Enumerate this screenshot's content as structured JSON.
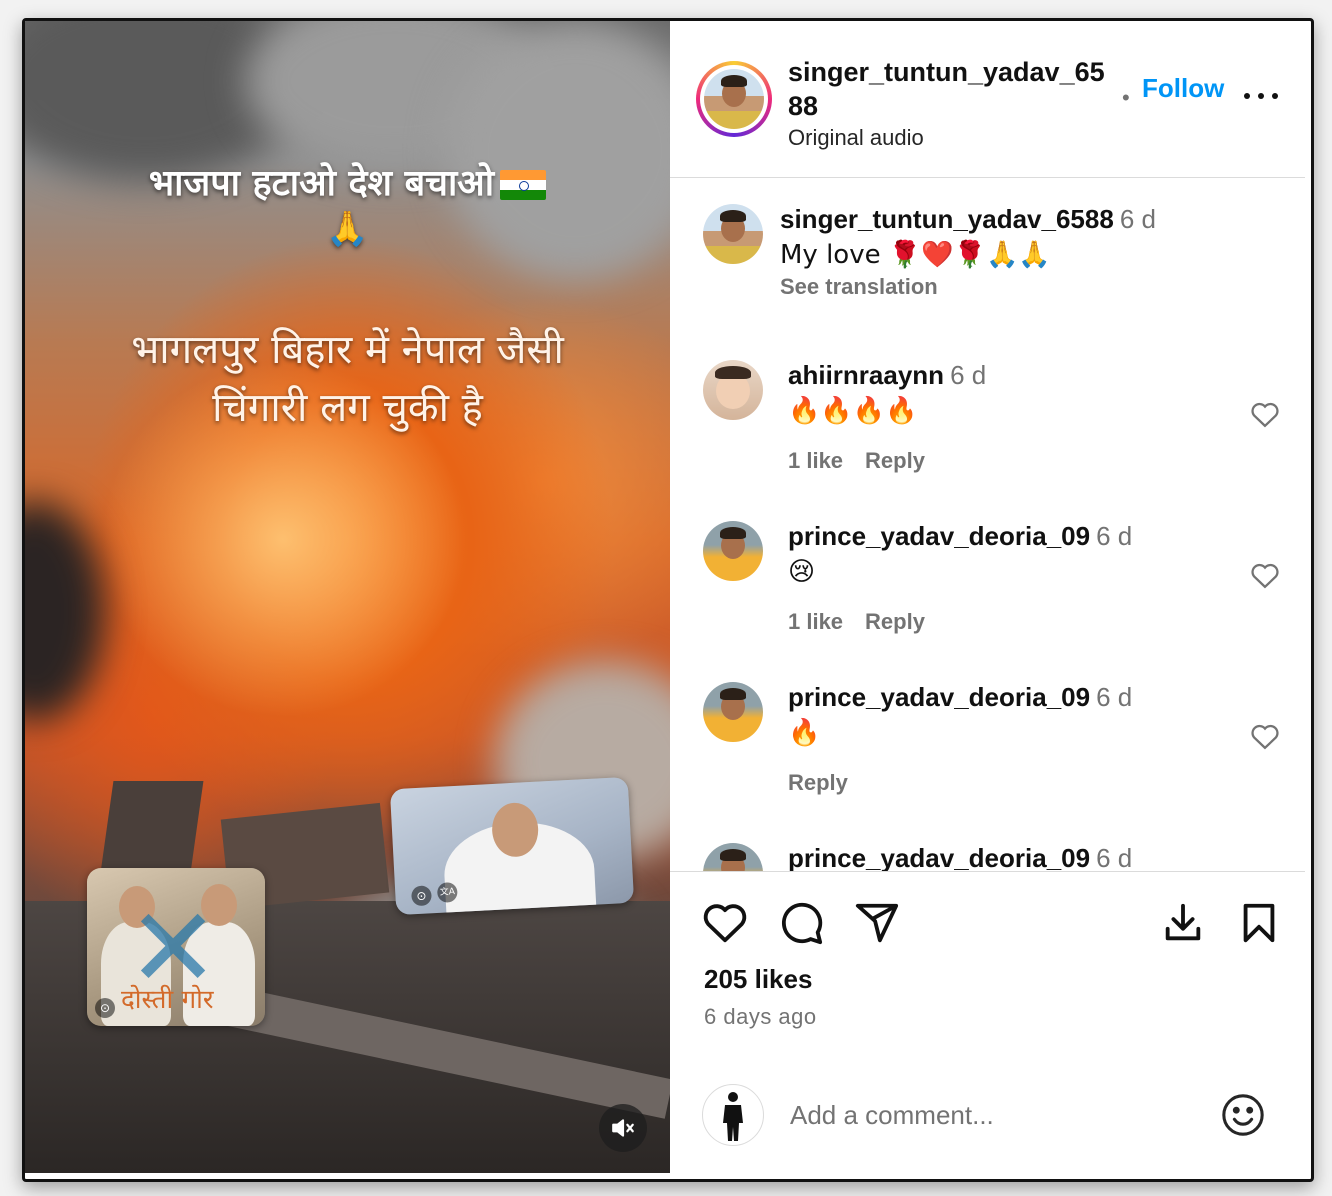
{
  "media": {
    "headline": "भाजपा हटाओ देश बचाओ",
    "headline_emoji": "🙏",
    "overlay_text_line1": "भागलपुर बिहार में नेपाल जैसी",
    "overlay_text_line2": "चिंगारी लग चुकी है",
    "sticker_left_caption": "दोस्ती गोर",
    "sticker_left_mark": "✕",
    "sticker_icon_glyph": "⊙",
    "sticker_translate_glyph": "文A"
  },
  "header": {
    "username": "singer_tuntun_yadav_6588",
    "audio": "Original audio",
    "separator": "•",
    "follow_label": "Follow"
  },
  "caption": {
    "username": "singer_tuntun_yadav_6588",
    "time": "6 d",
    "text": "My love 🌹❤️🌹🙏🙏",
    "translation_label": "See translation"
  },
  "comments": [
    {
      "username": "ahiirnraaynn",
      "time": "6 d",
      "text": "🔥🔥🔥🔥",
      "likes": "1 like",
      "reply": "Reply"
    },
    {
      "username": "prince_yadav_deoria_09",
      "time": "6 d",
      "text": "😢",
      "likes": "1 like",
      "reply": "Reply"
    },
    {
      "username": "prince_yadav_deoria_09",
      "time": "6 d",
      "text": "🔥",
      "likes": "",
      "reply": "Reply"
    },
    {
      "username": "prince_yadav_deoria_09",
      "time": "6 d",
      "text": "😢",
      "likes": "",
      "reply": ""
    }
  ],
  "footer": {
    "likes": "205 likes",
    "time_ago": "6 days ago",
    "comment_placeholder": "Add a comment..."
  },
  "icons": {
    "like": "heart-icon",
    "comment": "comment-icon",
    "share": "share-icon",
    "download": "download-icon",
    "save": "bookmark-icon",
    "emoji": "smiley-icon",
    "mute": "muted-speaker-icon",
    "more": "more-options-icon"
  },
  "colors": {
    "link_blue": "#0095f6",
    "muted_text": "#737373",
    "divider": "#dbdbdb"
  }
}
